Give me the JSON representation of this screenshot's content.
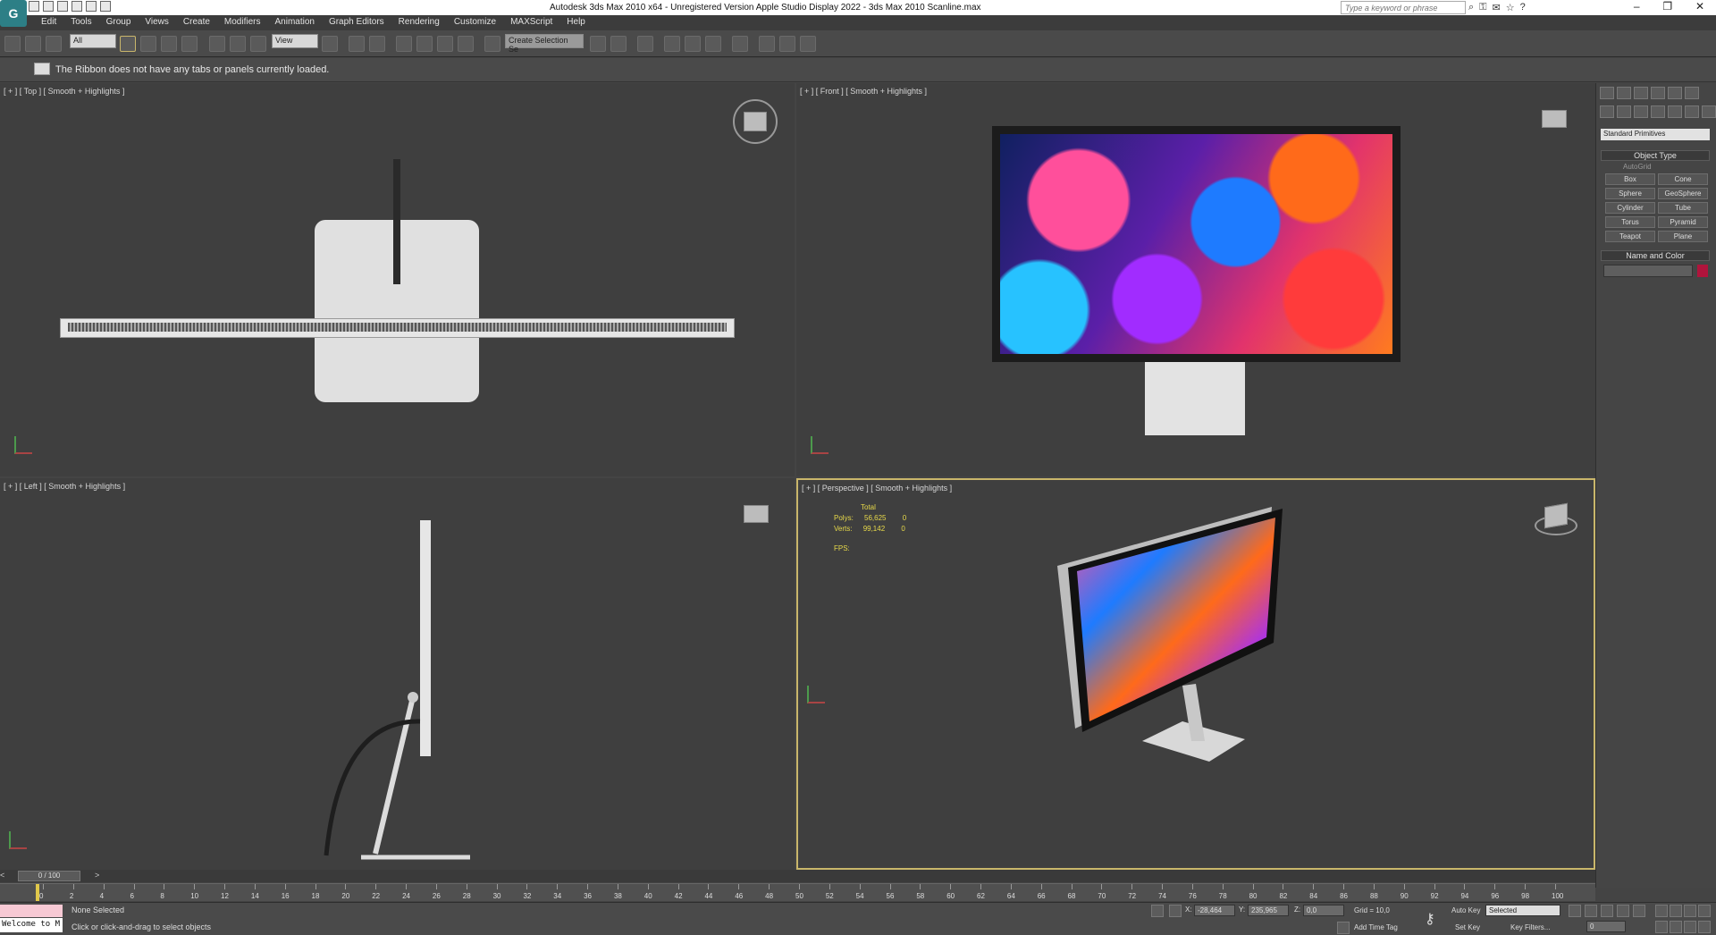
{
  "titlebar": {
    "title": "Autodesk 3ds Max  2010 x64  -  Unregistered Version        Apple Studio Display 2022 - 3ds Max 2010 Scanline.max",
    "app_button": "G",
    "search_placeholder": "Type a keyword or phrase",
    "minimize": "–",
    "restore": "❐",
    "close": "✕"
  },
  "menu": [
    "Edit",
    "Tools",
    "Group",
    "Views",
    "Create",
    "Modifiers",
    "Animation",
    "Graph Editors",
    "Rendering",
    "Customize",
    "MAXScript",
    "Help"
  ],
  "toolbar": {
    "filter_value": "All",
    "refcoord_value": "View",
    "named_selection_placeholder": "Create Selection Se"
  },
  "ribbon": {
    "message": "The Ribbon does not have any tabs or panels currently loaded."
  },
  "viewports": {
    "top": {
      "label": "[ + ] [ Top ] [ Smooth + Highlights ]"
    },
    "front": {
      "label": "[ + ] [ Front ] [ Smooth + Highlights ]"
    },
    "left": {
      "label": "[ + ] [ Left ] [ Smooth + Highlights ]"
    },
    "perspective": {
      "label": "[ + ] [ Perspective ] [ Smooth + Highlights ]",
      "stats": {
        "total_label": "Total",
        "polys_label": "Polys:",
        "polys_value": "56,625",
        "polys_sel": "0",
        "verts_label": "Verts:",
        "verts_value": "99,142",
        "verts_sel": "0",
        "fps_label": "FPS:"
      }
    }
  },
  "command_panel": {
    "dropdown": "Standard Primitives",
    "object_type_header": "Object Type",
    "autogrid": "AutoGrid",
    "primitives": [
      "Box",
      "Cone",
      "Sphere",
      "GeoSphere",
      "Cylinder",
      "Tube",
      "Torus",
      "Pyramid",
      "Teapot",
      "Plane"
    ],
    "name_color_header": "Name and Color",
    "swatch_color": "#b0143c"
  },
  "timeline": {
    "frame_counter": "0 / 100",
    "ticks": [
      "0",
      "2",
      "4",
      "6",
      "8",
      "10",
      "12",
      "14",
      "16",
      "18",
      "20",
      "22",
      "24",
      "26",
      "28",
      "30",
      "32",
      "34",
      "36",
      "38",
      "40",
      "42",
      "44",
      "46",
      "48",
      "50",
      "52",
      "54",
      "56",
      "58",
      "60",
      "62",
      "64",
      "66",
      "68",
      "70",
      "72",
      "74",
      "76",
      "78",
      "80",
      "82",
      "84",
      "86",
      "88",
      "90",
      "92",
      "94",
      "96",
      "98",
      "100"
    ]
  },
  "status": {
    "selection": "None Selected",
    "prompt": "Click or click-and-drag to select objects",
    "welcome": "Welcome to M",
    "x_label": "X:",
    "x_value": "-28,464",
    "y_label": "Y:",
    "y_value": "235,965",
    "z_label": "Z:",
    "z_value": "0,0",
    "grid": "Grid = 10,0",
    "add_time_tag": "Add Time Tag",
    "auto_key": "Auto Key",
    "set_key": "Set Key",
    "key_mode": "Selected",
    "key_filters": "Key Filters...",
    "current_frame": "0"
  },
  "colors": {
    "viewport_bg": "#3f3f3f",
    "active_border": "#c9b66b",
    "stats_text": "#e7d94a"
  }
}
